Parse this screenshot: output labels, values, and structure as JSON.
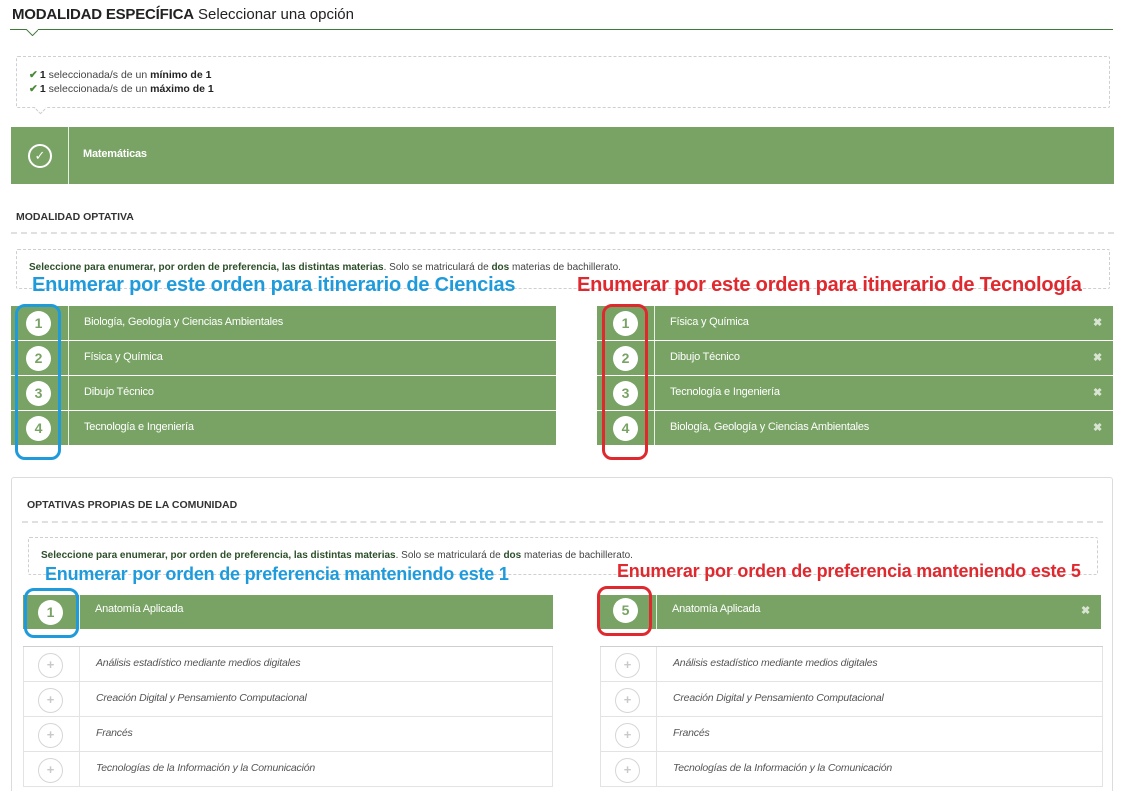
{
  "header": {
    "title_bold": "MODALIDAD ESPECÍFICA",
    "title_rest": "Seleccionar una opción"
  },
  "requirements": {
    "line1": {
      "count": "1",
      "mid": "seleccionada/s de un",
      "rule": "mínimo de 1"
    },
    "line2": {
      "count": "1",
      "mid": "seleccionada/s de un",
      "rule": "máximo de 1"
    }
  },
  "selected_subject": "Matemáticas",
  "modalidad_optativa": {
    "title": "MODALIDAD OPTATIVA",
    "instructions": {
      "bold": "Seleccione para enumerar, por orden de preferencia, las distintas materias",
      "pre": ". Solo se matriculará de",
      "count": "dos",
      "post": "materias de bachillerato."
    },
    "left_list": [
      {
        "num": "1",
        "label": "Biología, Geología y Ciencias Ambientales"
      },
      {
        "num": "2",
        "label": "Física y Química"
      },
      {
        "num": "3",
        "label": "Dibujo Técnico"
      },
      {
        "num": "4",
        "label": "Tecnología e Ingeniería"
      }
    ],
    "right_list": [
      {
        "num": "1",
        "label": "Física y Química"
      },
      {
        "num": "2",
        "label": "Dibujo Técnico"
      },
      {
        "num": "3",
        "label": "Tecnología e Ingeniería"
      },
      {
        "num": "4",
        "label": "Biología, Geología y Ciencias Ambientales"
      }
    ]
  },
  "optativas_comunidad": {
    "title": "OPTATIVAS PROPIAS DE LA COMUNIDAD",
    "instructions": {
      "bold": "Seleccione para enumerar, por orden de preferencia, las distintas materias",
      "pre": ". Solo se matriculará de",
      "count": "dos",
      "post": "materias de bachillerato."
    },
    "left_selected": {
      "num": "1",
      "label": "Anatomía Aplicada"
    },
    "right_selected": {
      "num": "5",
      "label": "Anatomía Aplicada"
    },
    "unselected": [
      "Análisis estadístico mediante medios digitales",
      "Creación Digital y Pensamiento Computacional",
      "Francés",
      "Tecnologías de la Información y la Comunicación"
    ]
  },
  "annotations": {
    "ciencias": "Enumerar por este orden para itinerario de Ciencias",
    "tecnologia": "Enumerar por este orden para itinerario de Tecnología",
    "keep1": "Enumerar por orden de preferencia manteniendo este 1",
    "keep5": "Enumerar por orden de preferencia manteniendo este 5"
  },
  "icons": {
    "check": "check-icon",
    "remove": "close-icon",
    "add": "plus-icon"
  },
  "colors": {
    "green": "#79a365",
    "dark_green": "#3e7a3a",
    "blue_annotation": "#1f9bdc",
    "red_annotation": "#e0292f"
  }
}
